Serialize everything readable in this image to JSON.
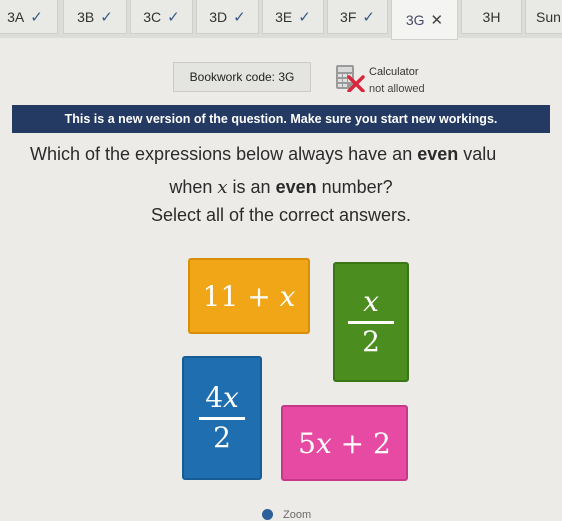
{
  "tabs": [
    {
      "label": "3A",
      "status": "✓"
    },
    {
      "label": "3B",
      "status": "✓"
    },
    {
      "label": "3C",
      "status": "✓"
    },
    {
      "label": "3D",
      "status": "✓"
    },
    {
      "label": "3E",
      "status": "✓"
    },
    {
      "label": "3F",
      "status": "✓"
    },
    {
      "label": "3G",
      "status": "✕"
    },
    {
      "label": "3H",
      "status": ""
    },
    {
      "label": "Sun",
      "status": ""
    }
  ],
  "header": {
    "bookwork_code": "Bookwork code: 3G",
    "calculator_title": "Calculator",
    "calculator_status": "not allowed"
  },
  "banner": "This is a new version of the question. Make sure you start new workings.",
  "question": {
    "line1_pre": "Which of the expressions below always have an ",
    "line1_bold": "even",
    "line1_post": " valu",
    "line2_pre": "when ",
    "line2_var": "x",
    "line2_mid": " is an ",
    "line2_bold": "even",
    "line2_post": " number?",
    "instruction": "Select all of the correct answers."
  },
  "answers": {
    "a1": {
      "num": "11",
      "op": "+",
      "var": "x"
    },
    "a2": {
      "numer": "x",
      "denom": "2"
    },
    "a3": {
      "coef": "4",
      "var": "x",
      "denom": "2"
    },
    "a4": {
      "coef": "5",
      "var": "x",
      "op": "+",
      "const": "2"
    }
  },
  "footer": {
    "zoom_label": "Zoom"
  },
  "colors": {
    "banner": "#243a63",
    "orange": "#f0a617",
    "green": "#4b8e1f",
    "blue": "#1f6fb0",
    "pink": "#e64aa2"
  }
}
